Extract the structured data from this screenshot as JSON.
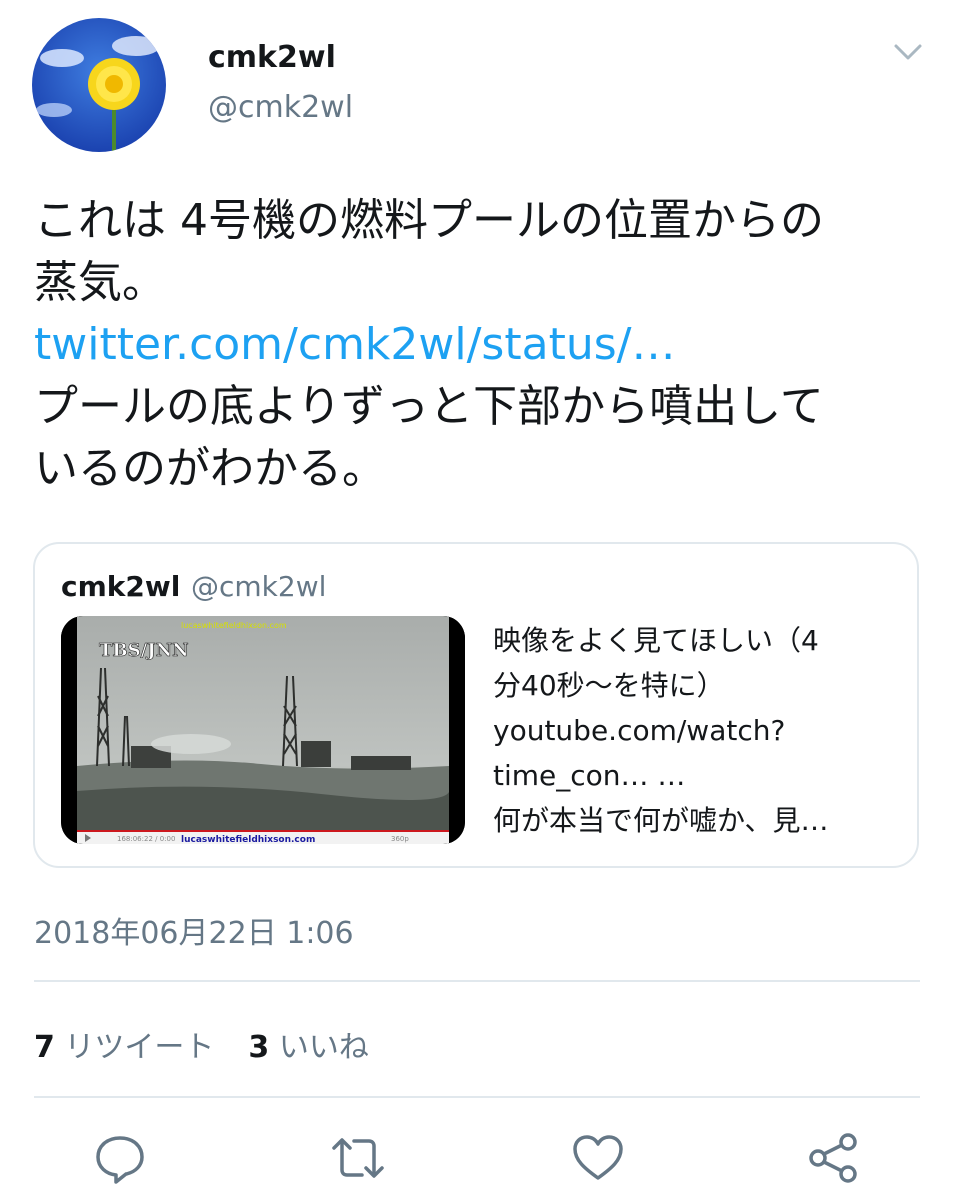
{
  "user": {
    "display_name": "cmk2wl",
    "handle": "@cmk2wl"
  },
  "tweet": {
    "line1": "これは 4号機の燃料プールの位置からの",
    "line2": "蒸気。",
    "link": "twitter.com/cmk2wl/status/…",
    "line3": "プールの底よりずっと下部から噴出して",
    "line4": "いるのがわかる。"
  },
  "quote": {
    "name": "cmk2wl",
    "handle": "@cmk2wl",
    "media": {
      "logo": "TBS/JNN",
      "watermark_top": "lucaswhitefieldhixson.com",
      "watermark_bottom": "lucaswhitefieldhixson.com",
      "time_readout": "168:06:22 / 0:00",
      "quality": "360p"
    },
    "lines": [
      "映像をよく見てほしい（4",
      "分40秒～を特に）",
      "youtube.com/watch?",
      "time_con… …",
      "何が本当で何が嘘か、見…"
    ]
  },
  "timestamp": "2018年06月22日 1:06",
  "stats": {
    "retweet_count": "7",
    "retweet_label": "リツイート",
    "like_count": "3",
    "like_label": "いいね"
  },
  "icons": {
    "caret": "chevron-down-icon",
    "reply": "reply-icon",
    "retweet": "retweet-icon",
    "like": "heart-icon",
    "share": "share-icon"
  },
  "colors": {
    "link": "#1da1f2",
    "secondary_text": "#657786",
    "primary_text": "#14171a",
    "border": "#e1e8ed"
  }
}
